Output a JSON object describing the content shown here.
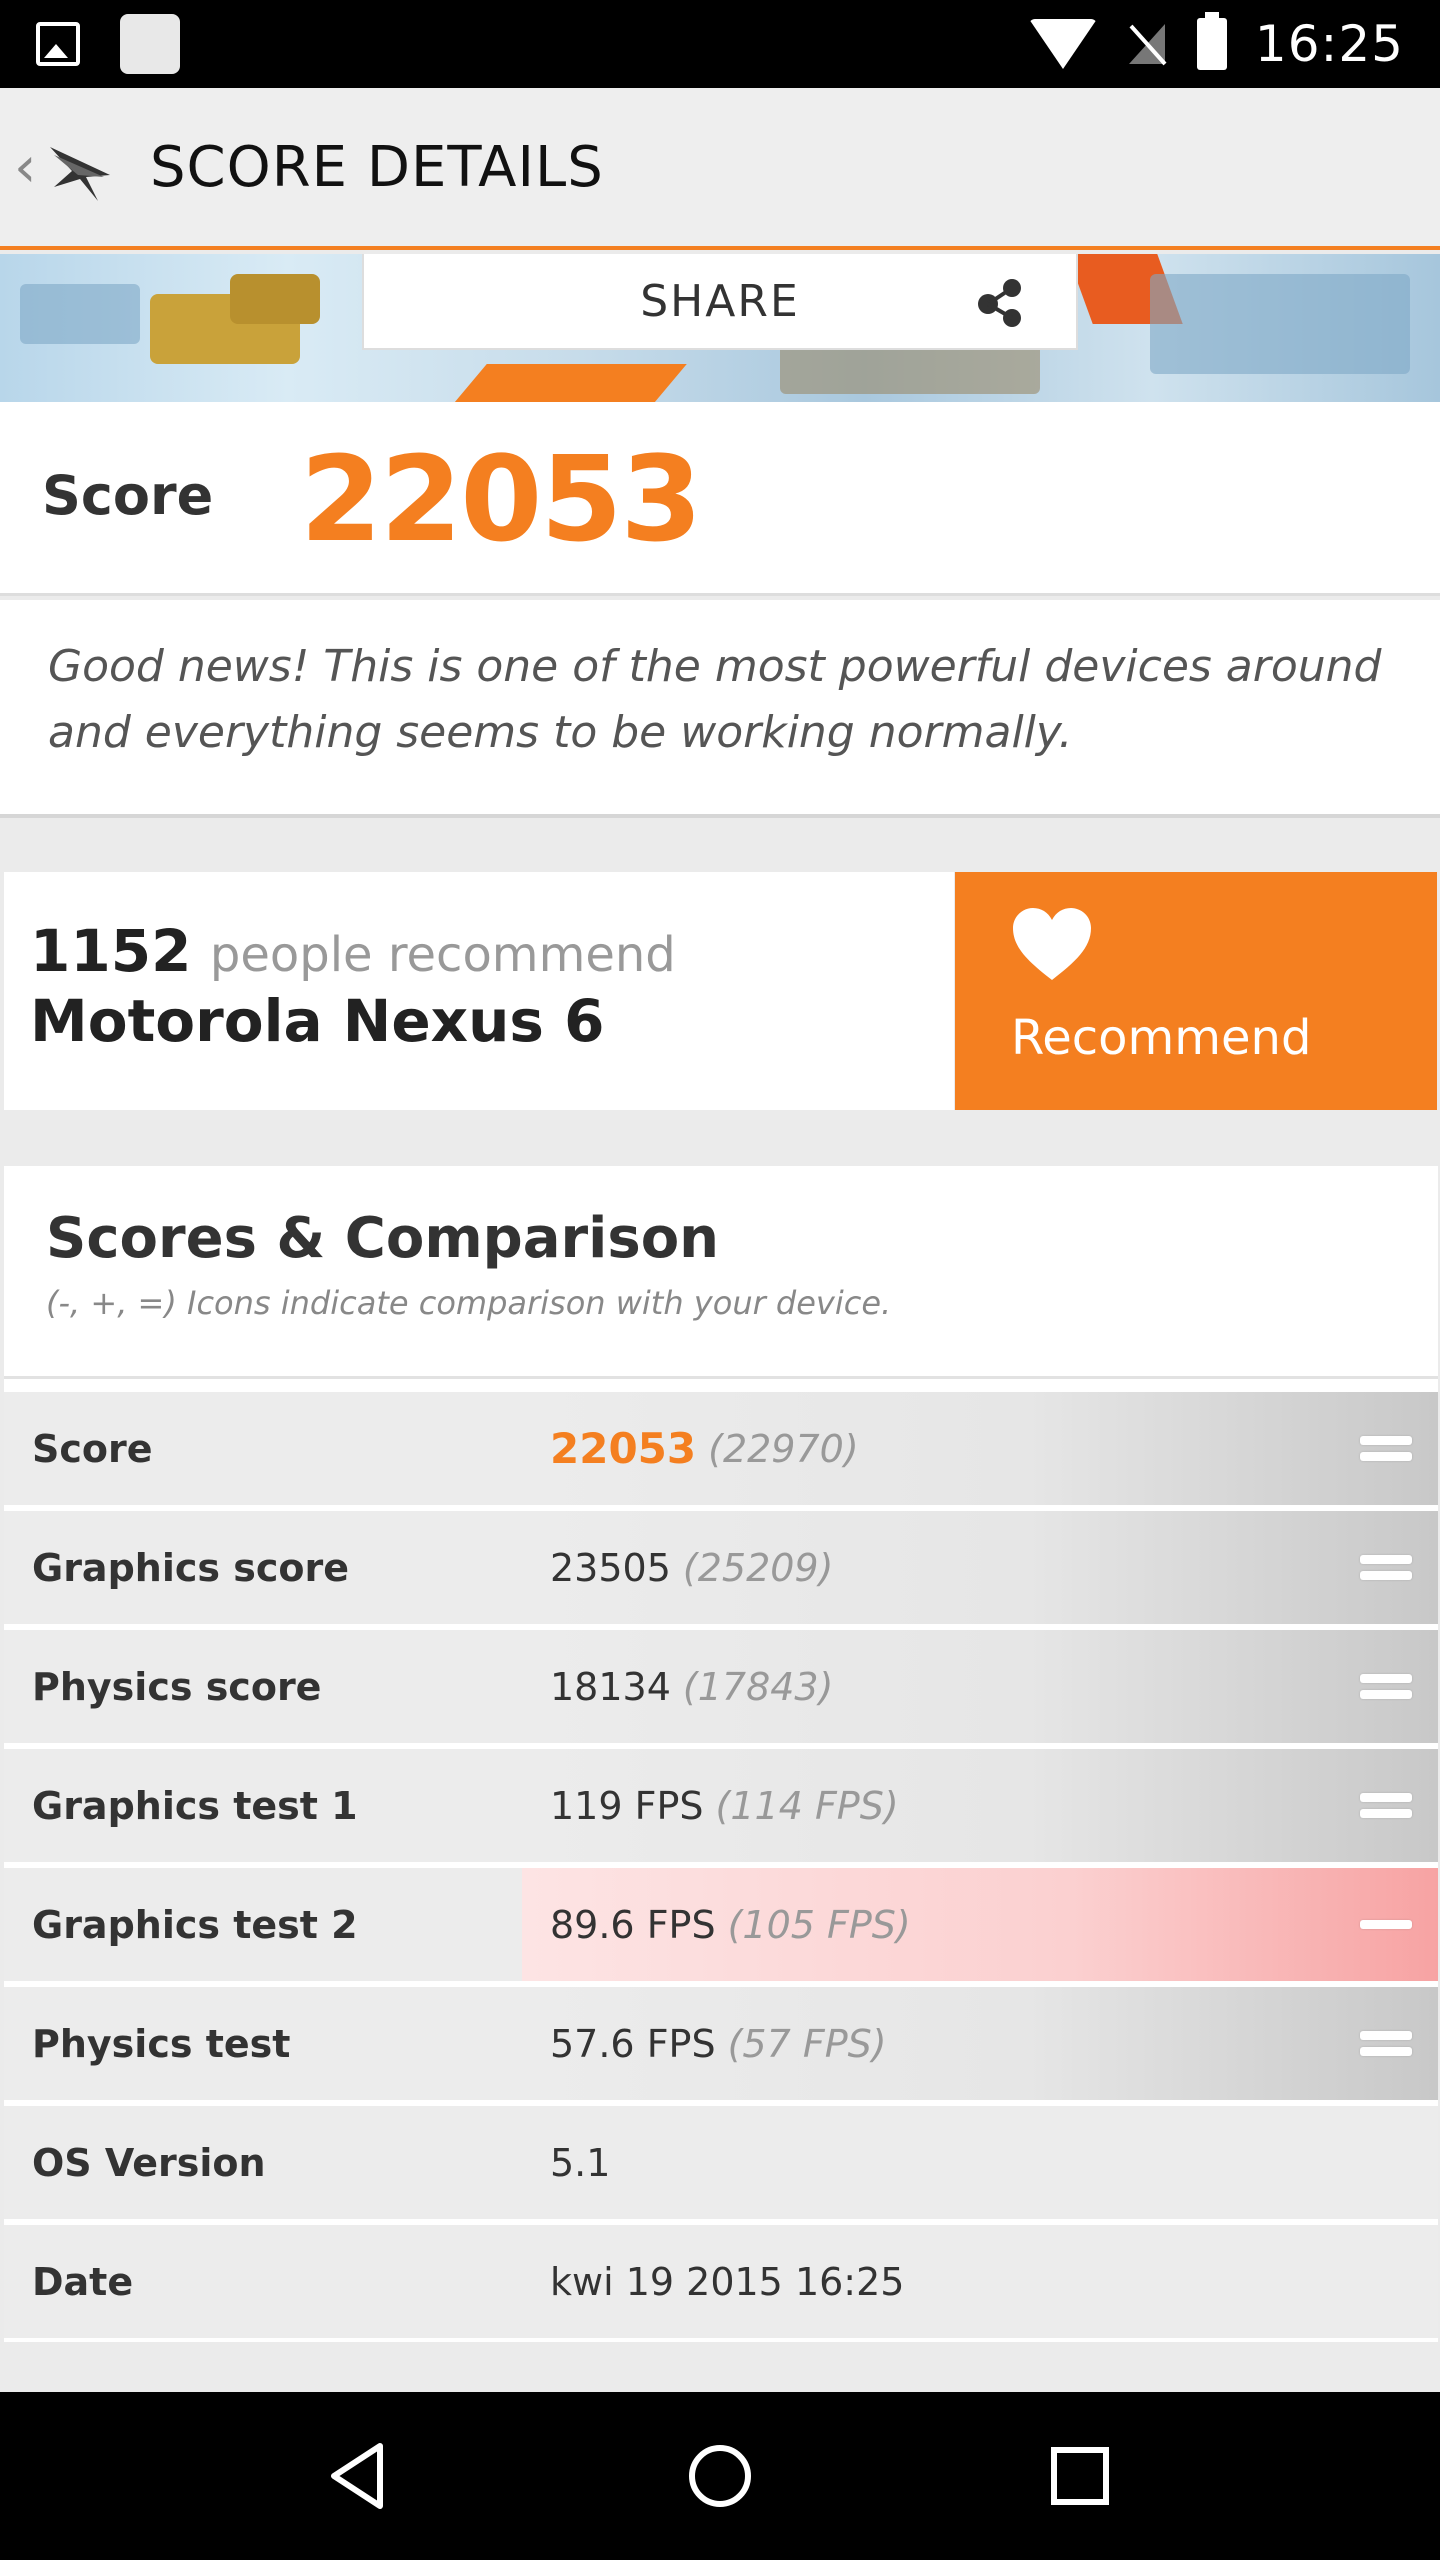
{
  "status_bar": {
    "time": "16:25",
    "icons": [
      "gallery-icon",
      "notification-square-icon",
      "wifi-icon",
      "no-signal-icon",
      "battery-icon"
    ]
  },
  "header": {
    "title": "SCORE DETAILS",
    "back_icon": "chevron-left-icon",
    "logo_icon": "3dmark-logo-icon"
  },
  "banner": {
    "share_label": "SHARE",
    "share_icon": "share-icon"
  },
  "score": {
    "label": "Score",
    "value": "22053"
  },
  "news": {
    "text": "Good news! This is one of the most powerful devices around and everything seems to be working normally."
  },
  "recommend": {
    "count": "1152",
    "middle_text": "people recommend",
    "device": "Motorola Nexus 6",
    "button_label": "Recommend",
    "button_icon": "heart-icon"
  },
  "comparison": {
    "title": "Scores & Comparison",
    "subtitle": "(-, +, =) Icons indicate comparison with your device.",
    "rows": [
      {
        "label": "Score",
        "value": "22053",
        "reference": "(22970)",
        "indicator": "equal"
      },
      {
        "label": "Graphics score",
        "value": "23505",
        "reference": "(25209)",
        "indicator": "equal"
      },
      {
        "label": "Physics score",
        "value": "18134",
        "reference": "(17843)",
        "indicator": "equal"
      },
      {
        "label": "Graphics test 1",
        "value": "119 FPS",
        "reference": "(114 FPS)",
        "indicator": "equal"
      },
      {
        "label": "Graphics test 2",
        "value": "89.6 FPS",
        "reference": "(105 FPS)",
        "indicator": "minus"
      },
      {
        "label": "Physics test",
        "value": "57.6 FPS",
        "reference": "(57 FPS)",
        "indicator": "equal"
      },
      {
        "label": "OS Version",
        "value": "5.1",
        "reference": "",
        "indicator": "none"
      },
      {
        "label": "Date",
        "value": "kwi 19 2015 16:25",
        "reference": "",
        "indicator": "none"
      }
    ]
  },
  "colors": {
    "accent": "#f47f20",
    "worse_highlight": "#f7a3a3"
  },
  "nav_bar": {
    "icons": [
      "back-triangle-icon",
      "home-circle-icon",
      "recents-square-icon"
    ]
  }
}
